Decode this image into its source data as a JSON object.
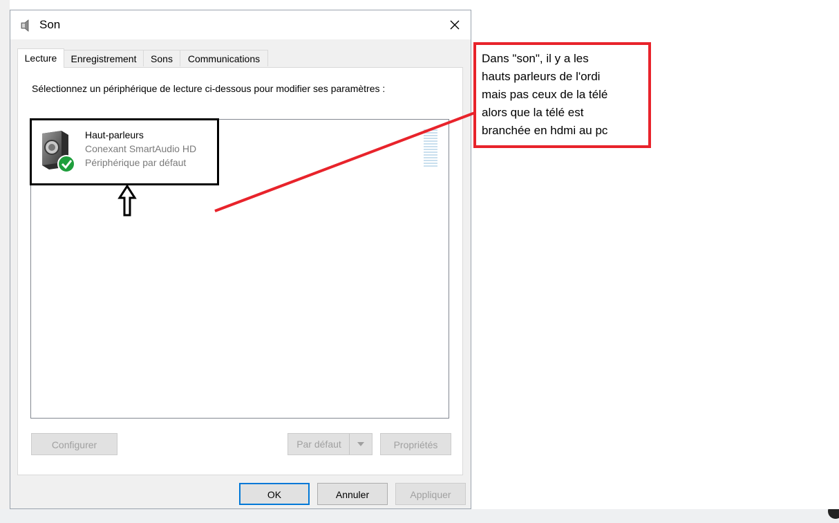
{
  "window": {
    "title": "Son"
  },
  "tabs": [
    {
      "label": "Lecture",
      "active": true
    },
    {
      "label": "Enregistrement",
      "active": false
    },
    {
      "label": "Sons",
      "active": false
    },
    {
      "label": "Communications",
      "active": false
    }
  ],
  "panel": {
    "instruction": "Sélectionnez un périphérique de lecture ci-dessous pour modifier ses paramètres :"
  },
  "devices": [
    {
      "name": "Haut-parleurs",
      "driver": "Conexant SmartAudio HD",
      "status": "Périphérique par défaut",
      "icon": "speaker-icon",
      "badge": "default-check-icon"
    }
  ],
  "panel_buttons": {
    "configure": "Configurer",
    "set_default": "Par défaut",
    "properties": "Propriétés"
  },
  "dialog_buttons": {
    "ok": "OK",
    "cancel": "Annuler",
    "apply": "Appliquer"
  },
  "annotation": {
    "lines": [
      "Dans \"son\", il y a les",
      "hauts parleurs de l'ordi",
      "mais pas ceux de la télé",
      "alors que la télé est",
      "branchée en hdmi au pc"
    ]
  },
  "colors": {
    "annotation_red": "#e8232b",
    "primary_border": "#0078d7",
    "check_green": "#1e9e3c"
  }
}
